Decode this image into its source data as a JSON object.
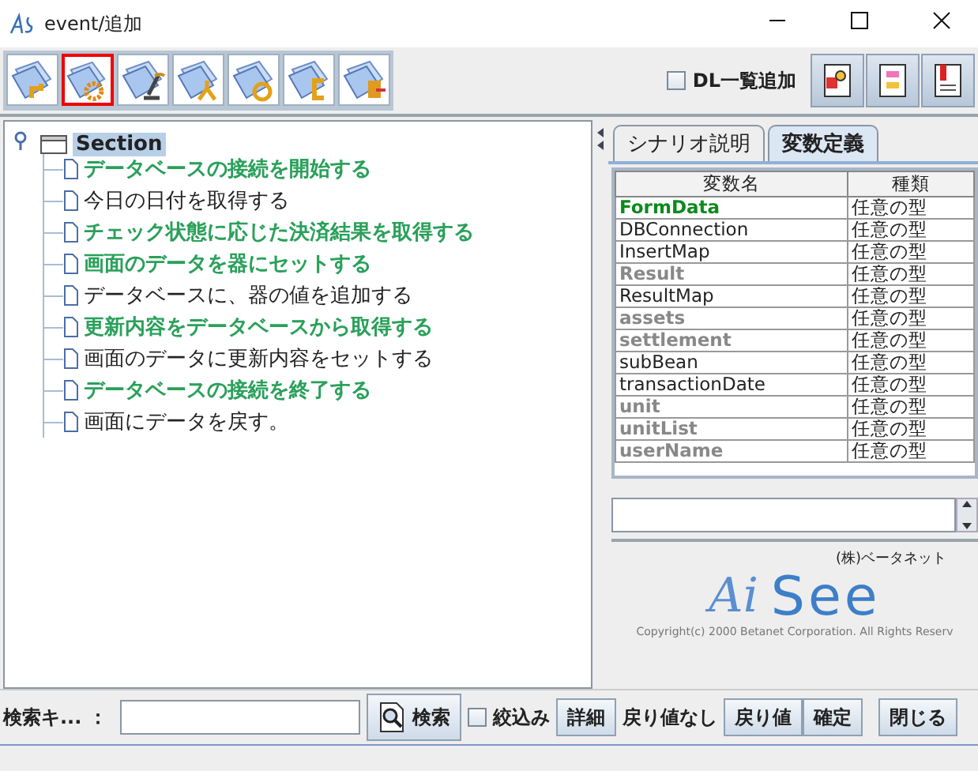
{
  "window": {
    "title": "event/追加"
  },
  "toolbar": {
    "tools": [
      {
        "selected": false
      },
      {
        "selected": true
      },
      {
        "selected": false
      },
      {
        "selected": false
      },
      {
        "selected": false
      },
      {
        "selected": false
      },
      {
        "selected": false
      }
    ],
    "dl_checkbox": {
      "label": "DL一覧追加",
      "checked": false
    }
  },
  "tree": {
    "root": {
      "label": "Section",
      "selected": true,
      "expanded": true,
      "children": [
        {
          "label": "データベースの接続を開始する",
          "highlighted": true
        },
        {
          "label": "今日の日付を取得する",
          "highlighted": false
        },
        {
          "label": "チェック状態に応じた決済結果を取得する",
          "highlighted": true
        },
        {
          "label": "画面のデータを器にセットする",
          "highlighted": true
        },
        {
          "label": "データベースに、器の値を追加する",
          "highlighted": false
        },
        {
          "label": "更新内容をデータベースから取得する",
          "highlighted": true
        },
        {
          "label": "画面のデータに更新内容をセットする",
          "highlighted": false
        },
        {
          "label": "データベースの接続を終了する",
          "highlighted": true
        },
        {
          "label": "画面にデータを戻す。",
          "highlighted": false
        }
      ]
    }
  },
  "tabs": [
    {
      "label": "シナリオ説明",
      "selected": false
    },
    {
      "label": "変数定義",
      "selected": true
    }
  ],
  "table": {
    "columns": [
      "変数名",
      "種類"
    ],
    "rows": [
      {
        "kind": "input",
        "cells": [
          "FormData",
          "任意の型"
        ]
      },
      {
        "kind": "used",
        "cells": [
          "DBConnection",
          "任意の型"
        ]
      },
      {
        "kind": "used",
        "cells": [
          "InsertMap",
          "任意の型"
        ]
      },
      {
        "kind": "unused",
        "cells": [
          "Result",
          "任意の型"
        ]
      },
      {
        "kind": "used",
        "cells": [
          "ResultMap",
          "任意の型"
        ]
      },
      {
        "kind": "unused",
        "cells": [
          "assets",
          "任意の型"
        ]
      },
      {
        "kind": "unused",
        "cells": [
          "settlement",
          "任意の型"
        ]
      },
      {
        "kind": "used",
        "cells": [
          "subBean",
          "任意の型"
        ]
      },
      {
        "kind": "used",
        "cells": [
          "transactionDate",
          "任意の型"
        ]
      },
      {
        "kind": "unused",
        "cells": [
          "unit",
          "任意の型"
        ]
      },
      {
        "kind": "unused",
        "cells": [
          "unitList",
          "任意の型"
        ]
      },
      {
        "kind": "unused",
        "cells": [
          "userName",
          "任意の型"
        ]
      }
    ]
  },
  "logo": {
    "company": "(株)ベータネット",
    "wordmark_1": "Ai",
    "wordmark_2": "See",
    "copyright": "Copyright(c) 2000 Betanet Corporation. All Rights Reserv"
  },
  "bottom_bar": {
    "search_label": "検索キ... ：",
    "search_button": "検索",
    "filter_checkbox": {
      "label": "絞込み",
      "checked": false
    },
    "detail_button": "詳細",
    "return_status": "戻り値なし",
    "return_button": "戻り値",
    "confirm_button": "確定",
    "close_button": "閉じる"
  }
}
